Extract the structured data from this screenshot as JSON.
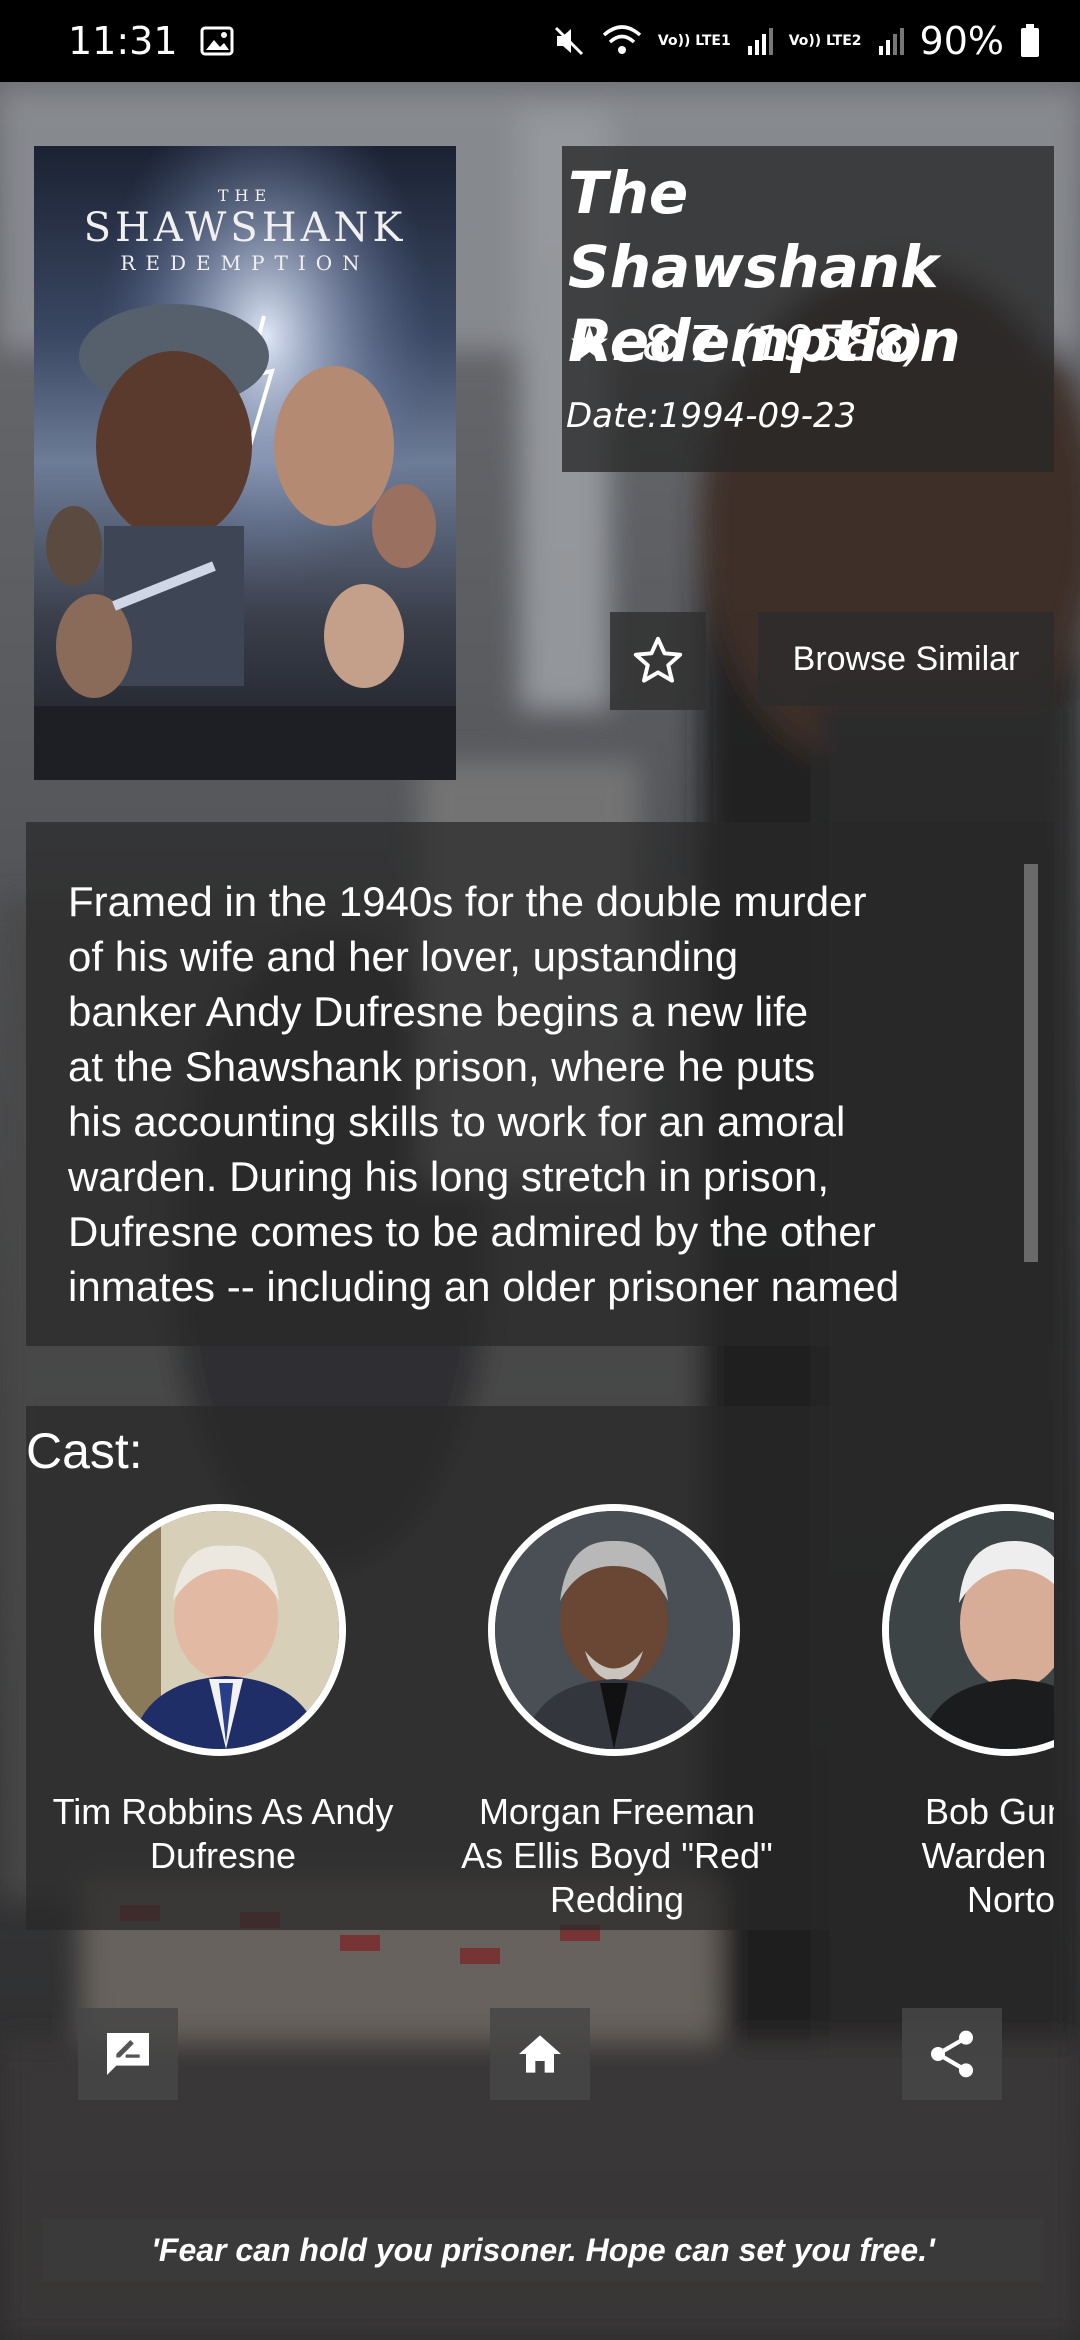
{
  "status_bar": {
    "time": "11:31",
    "battery": "90%",
    "sim1_label": "Vo)) LTE1",
    "sim2_label": "Vo)) LTE2"
  },
  "movie": {
    "title": "The Shawshank Redemption",
    "rating": "★: 8.7 (19588)",
    "release_date": "Date:1994-09-23",
    "poster": {
      "the": "THE",
      "title": "SHAWSHANK",
      "subtitle": "REDEMPTION"
    }
  },
  "actions": {
    "favorite_icon": "star-outline-icon",
    "browse_similar_label": "Browse Similar"
  },
  "overview": {
    "lines": [
      "Framed in the 1940s for the double murder",
      "of his wife and her lover, upstanding",
      "banker Andy Dufresne begins a new life",
      "at the Shawshank prison, where he puts",
      "his accounting skills to work for an amoral",
      "warden. During his long stretch in prison,",
      "Dufresne comes to be admired by the other",
      "inmates -- including an older prisoner named"
    ]
  },
  "cast": {
    "heading": "Cast:",
    "members": [
      {
        "line1": "Tim Robbins As Andy",
        "line2": "Dufresne",
        "line3": ""
      },
      {
        "line1": "Morgan Freeman",
        "line2": "As Ellis Boyd \"Red\"",
        "line3": "Redding"
      },
      {
        "line1": "Bob Gunto",
        "line2": "Warden Sa",
        "line3": "Norto"
      }
    ]
  },
  "bottom_nav": {
    "review_icon": "rate-review-icon",
    "home_icon": "home-icon",
    "share_icon": "share-icon"
  },
  "tagline": "'Fear can hold you prisoner. Hope can set you free.'",
  "colors": {
    "panel": "#282828",
    "status_bar": "#000000",
    "text": "#ffffff"
  }
}
